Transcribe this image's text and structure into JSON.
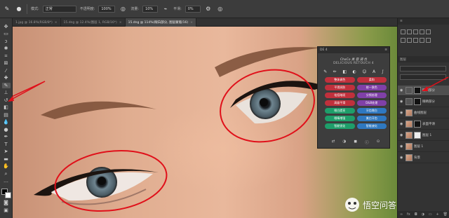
{
  "options_bar": {
    "mode_label": "模式:",
    "mode_value": "正常",
    "opacity_label": "不透明度:",
    "opacity_value": "100%",
    "flow_label": "流量:",
    "flow_value": "10%",
    "smoothing_label": "平滑:",
    "smoothing_value": "0%"
  },
  "tabs": [
    {
      "label": "1.jpg @ 16.8%(RGB/8*)",
      "active": false
    },
    {
      "label": "15.dng @ 12.4%(图层 1, RGB/16*)",
      "active": false
    },
    {
      "label": "15.dng @ 114%(眼白部分, 图层蒙版/16)",
      "active": true
    }
  ],
  "plugin": {
    "header": "DE 4",
    "title_line1": "ChaCo 美 容 调 色",
    "title_line2": "DELICIOUS RETOUCH 4",
    "buttons": [
      {
        "label": "整体调色",
        "color": "red"
      },
      {
        "label": "柔和",
        "color": "red"
      },
      {
        "label": "平滑润肤",
        "color": "red"
      },
      {
        "label": "统一肤色",
        "color": "purple"
      },
      {
        "label": "祛痘暗斑",
        "color": "red"
      },
      {
        "label": "分频处理",
        "color": "purple"
      },
      {
        "label": "高级平滑",
        "color": "red"
      },
      {
        "label": "D&B处理",
        "color": "purple"
      },
      {
        "label": "眼白提亮",
        "color": "green"
      },
      {
        "label": "牙齿增白",
        "color": "blue"
      },
      {
        "label": "眼睛增强",
        "color": "green"
      },
      {
        "label": "美白牙齿",
        "color": "blue"
      },
      {
        "label": "智能锐化",
        "color": "green"
      },
      {
        "label": "智能液化",
        "color": "blue"
      }
    ]
  },
  "layers_panel": {
    "title": "图层",
    "layers": [
      {
        "name": "眼白部分",
        "thumb": "dark",
        "selected": true
      },
      {
        "name": "眼睛部分",
        "thumb": "dark",
        "selected": false
      },
      {
        "name": "曲线图层",
        "thumb": "face",
        "selected": false
      },
      {
        "name": "表面平滑",
        "thumb": "face",
        "selected": false
      },
      {
        "name": "图层 1",
        "thumb": "white",
        "selected": false
      },
      {
        "name": "图层 1",
        "thumb": "face",
        "selected": false
      },
      {
        "name": "背景",
        "thumb": "face",
        "selected": false
      }
    ]
  },
  "watermark": "悟空问答",
  "colors": {
    "annotation_red": "#e0101a",
    "workspace": "#2b2b2b",
    "selected_layer": "#4f4f4f"
  }
}
